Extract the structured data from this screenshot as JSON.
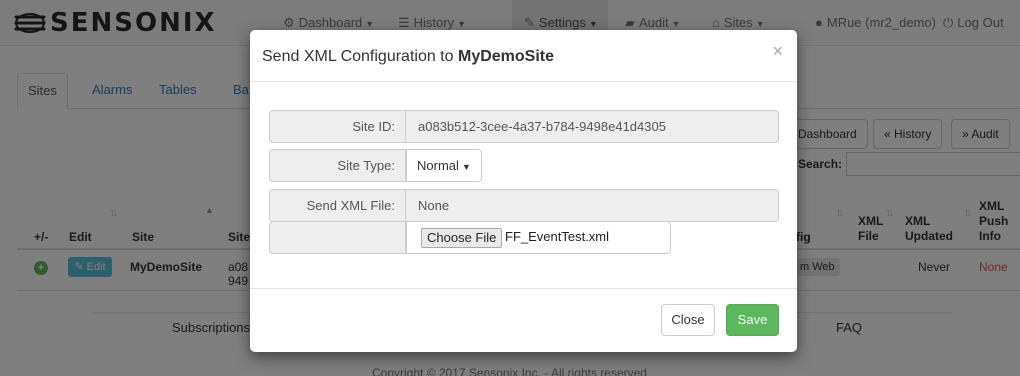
{
  "brand": {
    "name": "SENSONIX",
    "logo_icon": "sensonix-logo-icon"
  },
  "navbar": {
    "dashboard": "Dashboard",
    "history": "History",
    "settings": "Settings",
    "audit": "Audit",
    "sites": "Sites",
    "user": "MRue (mr2_demo)",
    "logout": "Log Out"
  },
  "tabs": [
    "Sites",
    "Alarms",
    "Tables",
    "Ba"
  ],
  "toolbar": {
    "dashboard_btn": "Dashboard",
    "history_btn": "« History",
    "audit_btn": "» Audit",
    "search_label": "Search:"
  },
  "table": {
    "headers": {
      "plus_minus": "+/-",
      "edit": "Edit",
      "site": "Site",
      "site_id": "Site",
      "config": "fig",
      "xml_file_1": "XML",
      "xml_file_2": "File",
      "xml_updated_1": "XML",
      "xml_updated_2": "Updated",
      "xml_push_1": "XML",
      "xml_push_2": "Push",
      "xml_push_3": "Info"
    },
    "row": {
      "edit_label": "Edit",
      "site": "MyDemoSite",
      "site_id_1": "a08",
      "site_id_2": "949",
      "config": "m Web",
      "xml_updated": "Never",
      "xml_push": "None"
    }
  },
  "footer": {
    "subscriptions": "Subscriptions",
    "faq": "FAQ",
    "copyright": "Copyright © 2017 Sensonix Inc. - All rights reserved"
  },
  "modal": {
    "title_prefix": "Send XML Configuration to",
    "title_site": "MyDemoSite",
    "close_x": "×",
    "fields": {
      "site_id_label": "Site ID:",
      "site_id_value": "a083b512-3cee-4a37-b784-9498e41d4305",
      "site_type_label": "Site Type:",
      "site_type_value": "Normal",
      "send_xml_label": "Send XML File:",
      "send_xml_value": "None",
      "choose_file_label": "Choose File",
      "file_name": "FF_EventTest.xml"
    },
    "buttons": {
      "close": "Close",
      "save": "Save"
    }
  },
  "colors": {
    "save_green": "#5cb85c",
    "link_blue": "#337ab7",
    "edit_cyan": "#5bc0de",
    "none_red": "#d9534f"
  }
}
